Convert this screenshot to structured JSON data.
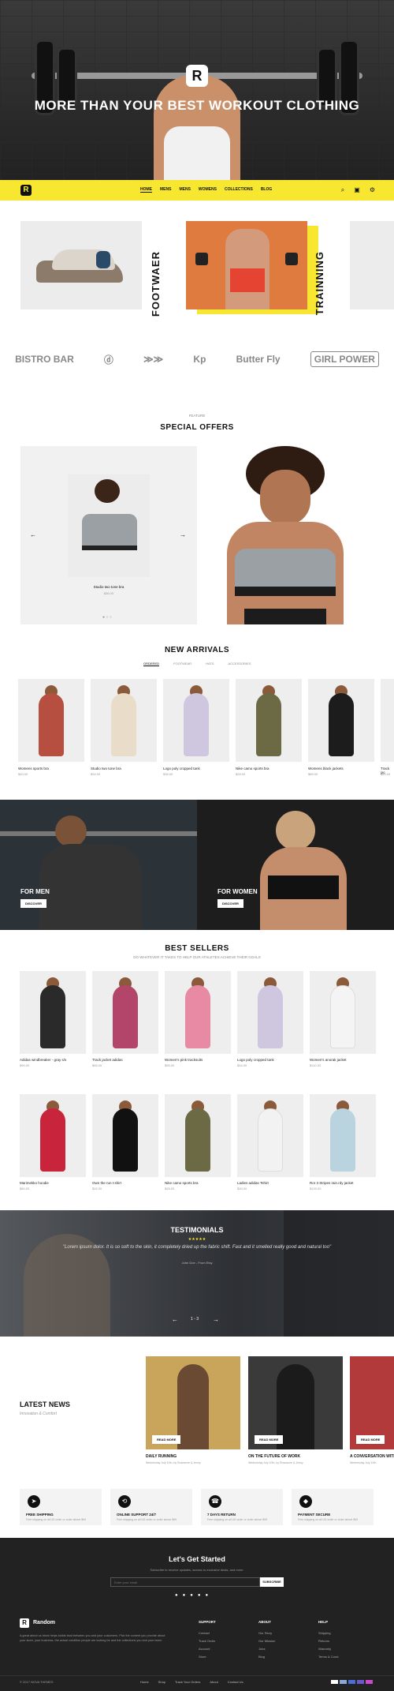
{
  "hero": {
    "title": "MORE THAN YOUR BEST WORKOUT CLOTHING",
    "logo": "R"
  },
  "nav": {
    "items": [
      "HOME",
      "MENS",
      "MENS",
      "WOMENS",
      "COLLECTIONS",
      "BLOG"
    ],
    "active": 0
  },
  "categories": [
    {
      "label": "FOOTWAER"
    },
    {
      "label": "TRAINNING"
    }
  ],
  "brands": [
    "BISTRO BAR",
    "ⓓ",
    "≫≫",
    "Kp",
    "Butter Fly",
    "GIRL POWER"
  ],
  "special": {
    "eyebrow": "FEATURE",
    "title": "SPECIAL OFFERS",
    "product_name": "Studio two tone bra",
    "product_price": "$36.00"
  },
  "new_arrivals": {
    "title": "NEW ARRIVALS",
    "tabs": [
      "ORDERED",
      "FOOTWEAR",
      "HATS",
      "ACCESSORIES"
    ],
    "products": [
      {
        "name": "Womens sports bra",
        "price": "$40.00",
        "color": "#b64f3f"
      },
      {
        "name": "Studio two tone bra",
        "price": "$34.00",
        "color": "#e9dcc8"
      },
      {
        "name": "Logo poly cropped tank",
        "price": "$36.00",
        "color": "#cfc6e0"
      },
      {
        "name": "Nike camo sports bra",
        "price": "$28.00",
        "color": "#6b6a45"
      },
      {
        "name": "Womens black jackets",
        "price": "$85.00",
        "color": "#1c1c1c"
      },
      {
        "name": "Track jac",
        "price": "$60.00",
        "color": "#444"
      }
    ]
  },
  "promo": {
    "men_label": "FOR MEN",
    "women_label": "FOR WOMEN",
    "button": "DISCOVER"
  },
  "best_sellers": {
    "title": "BEST SELLERS",
    "subtitle": "DO WHATEVER IT TAKES TO HELP OUR ATHLETES ACHIEVE THEIR GOALS",
    "row1": [
      {
        "name": "Adidas windbreaker - gray s/s",
        "price": "$90.00",
        "color": "#2a2a2a"
      },
      {
        "name": "Track jacket adidas",
        "price": "$55.00",
        "color": "#b3456a"
      },
      {
        "name": "Women's pink tracksuits",
        "price": "$95.00",
        "color": "#e98aa4"
      },
      {
        "name": "Logo poly cropped tank",
        "price": "$34.00",
        "color": "#cfc6e0"
      },
      {
        "name": "Women's anorak jacket",
        "price": "$110.00",
        "color": "#f4f4f4"
      }
    ],
    "row2": [
      {
        "name": "Marimekko hoodie",
        "price": "$80.00",
        "color": "#c8243b"
      },
      {
        "name": "Own the run t-shirt",
        "price": "$32.00",
        "color": "#111"
      },
      {
        "name": "Nike camo sports bra",
        "price": "$28.00",
        "color": "#6b6a45"
      },
      {
        "name": "Ladies adidas Tshirt",
        "price": "$30.00",
        "color": "#f2f2f2"
      },
      {
        "name": "Ror 3 Stripes rain.rdy jacket",
        "price": "$120.00",
        "color": "#b9d4df"
      }
    ]
  },
  "testimonials": {
    "title": "TESTIMONIALS",
    "stars": "★★★★★",
    "quote": "\"Lorem ipsum dolor. It is so soft to the skin, it completely dried up the fabric shift. Fast and it smelled really good and natural too\"",
    "author": "John Doe - From Etsy",
    "pager": "1 - 3"
  },
  "news": {
    "title": "LATEST NEWS",
    "subtitle": "Innovation & Comfort",
    "button": "READ MORE",
    "posts": [
      {
        "title": "DAILY RUNNING",
        "meta": "Wednesday July 10th, by Roseanne & Jenny",
        "color": "#c8a55b"
      },
      {
        "title": "ON THE FUTURE OF WORK",
        "meta": "Wednesday July 10th, by Roseanne & Jenny",
        "color": "#3a3a3a"
      },
      {
        "title": "A CONVERSATION WITH",
        "meta": "Wednesday July 10th",
        "color": "#b23a3a"
      }
    ]
  },
  "features": [
    {
      "icon": "➤",
      "title": "FREE SHIPPING",
      "desc": "Free shipping on all US order or order above $99"
    },
    {
      "icon": "⟲",
      "title": "ONLINE SUPPORT 24/7",
      "desc": "Free shipping on all US order or order above $99"
    },
    {
      "icon": "☎",
      "title": "7 DAYS RETURN",
      "desc": "Free shipping on all US order or order above $99"
    },
    {
      "icon": "◆",
      "title": "PAYMENT SECURE",
      "desc": "Free shipping on all US order or order above $99"
    }
  ],
  "newsletter": {
    "title": "Let's Get Started",
    "subtitle": "Subscribe to receive updates, access to exclusive deals, and more.",
    "placeholder": "Enter your email",
    "button": "SUBSCRIBE"
  },
  "footer": {
    "brand": "Random",
    "about": "A great about us block helps builds trust between you and your customers. Pick the content you provide about your store, your business, the actual condition people are looking for and the collections you and your team.",
    "columns": [
      {
        "title": "SUPPORT",
        "items": [
          "Contact",
          "Track Order",
          "Account",
          "Store"
        ]
      },
      {
        "title": "ABOUT",
        "items": [
          "Our Story",
          "Our Mission",
          "Jobs",
          "Blog"
        ]
      },
      {
        "title": "HELP",
        "items": [
          "Shipping",
          "Returns",
          "Warranty",
          "Terms & Cond."
        ]
      }
    ],
    "copyright": "© 2017 NOVA THEMES",
    "links": [
      "Home",
      "Shop",
      "Track Your Orders",
      "About",
      "Contact Us"
    ]
  }
}
